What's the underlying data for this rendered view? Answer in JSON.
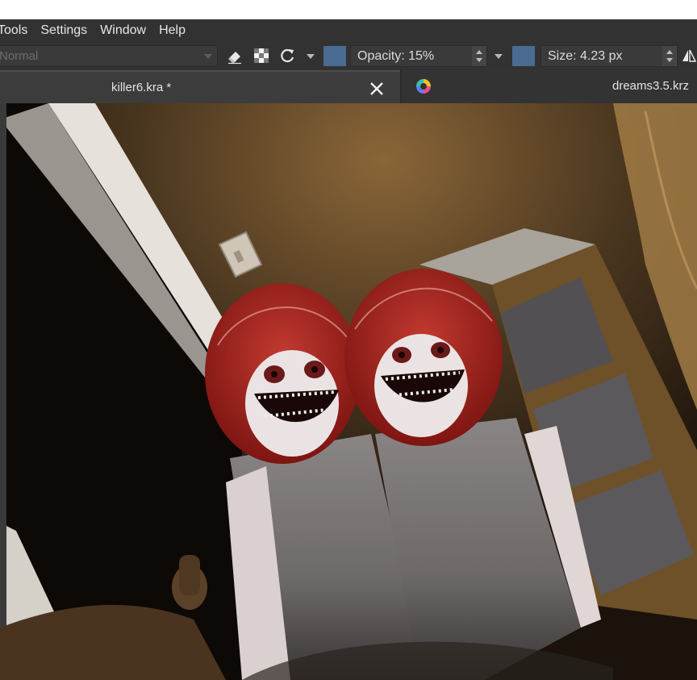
{
  "menu": [
    "Tools",
    "Settings",
    "Window",
    "Help"
  ],
  "toolbar": {
    "blend_mode": "Normal",
    "opacity_label": "Opacity: 15%",
    "size_label": "Size: 4.23 px"
  },
  "tabs": [
    {
      "label": "killer6.kra *"
    },
    {
      "label": "dreams3.5.krz"
    }
  ],
  "colors": {
    "brush_swatch": "#4a6c93",
    "ui_background": "#323232"
  },
  "icons": [
    "eraser-icon",
    "alpha-lock-icon",
    "reload-preset-icon",
    "close-icon",
    "krita-app-icon",
    "mirror-icon"
  ]
}
